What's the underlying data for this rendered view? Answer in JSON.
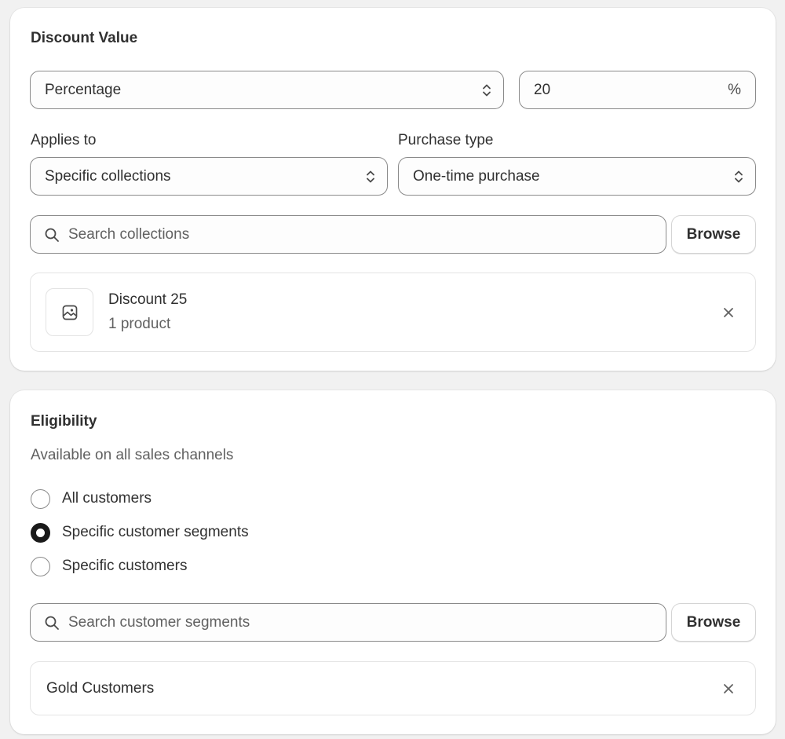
{
  "discount_value": {
    "title": "Discount Value",
    "type_select": {
      "value": "Percentage"
    },
    "amount": {
      "value": "20",
      "suffix": "%"
    },
    "applies_to": {
      "label": "Applies to",
      "value": "Specific collections"
    },
    "purchase_type": {
      "label": "Purchase type",
      "value": "One-time purchase"
    },
    "search": {
      "placeholder": "Search collections",
      "browse_label": "Browse"
    },
    "selected_collection": {
      "title": "Discount 25",
      "subtitle": "1 product"
    }
  },
  "eligibility": {
    "title": "Eligibility",
    "subtitle": "Available on all sales channels",
    "options": [
      {
        "label": "All customers",
        "checked": false
      },
      {
        "label": "Specific customer segments",
        "checked": true
      },
      {
        "label": "Specific customers",
        "checked": false
      }
    ],
    "search": {
      "placeholder": "Search customer segments",
      "browse_label": "Browse"
    },
    "selected_segment": {
      "title": "Gold Customers"
    }
  },
  "icons": {
    "select": "chevron-up-down-icon",
    "search": "search-icon",
    "thumbnail": "image-icon",
    "remove": "close-icon"
  }
}
